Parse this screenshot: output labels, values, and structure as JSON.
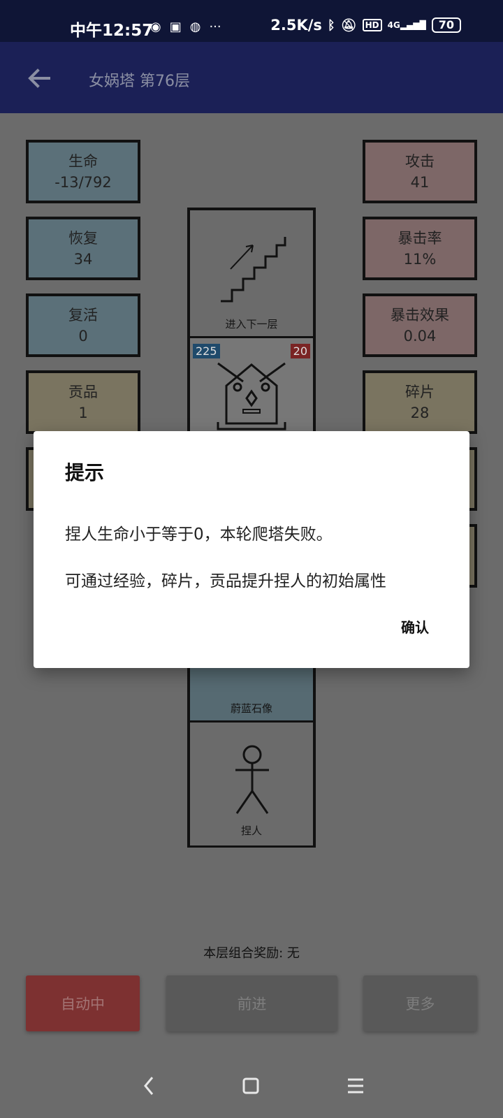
{
  "status_bar": {
    "time": "中午12:57",
    "network_speed": "2.5K/s",
    "signal": "4G",
    "battery": "70",
    "hd": "HD",
    "more": "···"
  },
  "app_bar": {
    "title": "女娲塔 第76层"
  },
  "stats_left": [
    {
      "label": "生命",
      "value": "-13/792"
    },
    {
      "label": "恢复",
      "value": "34"
    },
    {
      "label": "复活",
      "value": "0"
    },
    {
      "label": "贡品",
      "value": "1"
    }
  ],
  "stats_right": [
    {
      "label": "攻击",
      "value": "41"
    },
    {
      "label": "暴击率",
      "value": "11%"
    },
    {
      "label": "暴击效果",
      "value": "0.04"
    },
    {
      "label": "碎片",
      "value": "28"
    }
  ],
  "tower": {
    "stairs_label": "进入下一层",
    "enemy_hp": "225",
    "enemy_atk": "20",
    "statue_label": "蔚蓝石像",
    "player_label": "捏人"
  },
  "bottom": {
    "reward_text": "本层组合奖励: 无",
    "auto_label": "自动中",
    "next_label": "前进",
    "more_label": "更多"
  },
  "dialog": {
    "title": "提示",
    "message1": "捏人生命小于等于0，本轮爬塔失败。",
    "message2": "可通过经验，碎片，贡品提升捏人的初始属性",
    "confirm_label": "确认"
  },
  "colors": {
    "status_bar_bg": "#0f1536",
    "app_bar_bg": "#1b2056",
    "auto_button_bg": "#7d3131"
  }
}
